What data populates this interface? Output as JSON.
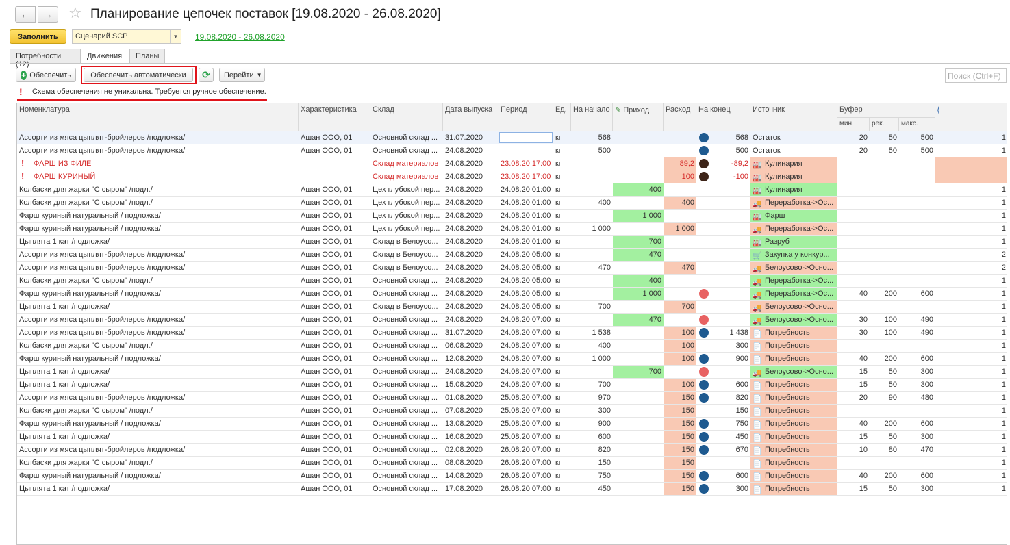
{
  "window": {
    "title": "Планирование цепочек поставок [19.08.2020 - 26.08.2020]"
  },
  "commandbar": {
    "fill_label": "Заполнить",
    "scenario_value": "Сценарий SCP",
    "period_link": "19.08.2020 - 26.08.2020"
  },
  "tabs": [
    {
      "label": "Потребности (12)"
    },
    {
      "label": "Движения"
    },
    {
      "label": "Планы"
    }
  ],
  "toolbar": {
    "provide_label": "Обеспечить",
    "provide_auto_label": "Обеспечить автоматически",
    "goto_label": "Перейти",
    "search_placeholder": "Поиск (Ctrl+F)"
  },
  "warning": {
    "text": "Схема обеспечения не уникальна. Требуется ручное обеспечение."
  },
  "columns": {
    "nom": "Номенклатура",
    "char": "Характеристика",
    "store": "Склад",
    "release": "Дата выпуска",
    "period": "Период",
    "unit": "Ед.",
    "start": "На начало",
    "income": "Приход",
    "expense": "Расход",
    "end": "На конец",
    "source": "Источник",
    "buffer": "Буфер",
    "buf_min": "мин.",
    "buf_rec": "рек.",
    "buf_max": "макс."
  },
  "rows": [
    {
      "nom": "Ассорти из мяса цыплят-бройлеров /подложка/",
      "char": "Ашан ООО, 01",
      "store": "Основной склад ...",
      "release": "31.07.2020",
      "period": "",
      "unit": "кг",
      "start": "568",
      "income": "",
      "expense": "",
      "end": "568",
      "dot": "blue",
      "src": "Остаток",
      "srcbg": "",
      "srcic": "",
      "min": "20",
      "rec": "50",
      "max": "500",
      "last": "1",
      "sel": true
    },
    {
      "nom": "Ассорти из мяса цыплят-бройлеров /подложка/",
      "char": "Ашан ООО, 01",
      "store": "Основной склад ...",
      "release": "24.08.2020",
      "period": "",
      "unit": "кг",
      "start": "500",
      "income": "",
      "expense": "",
      "end": "500",
      "dot": "blue",
      "src": "Остаток",
      "srcbg": "",
      "srcic": "",
      "min": "20",
      "rec": "50",
      "max": "500",
      "last": "1"
    },
    {
      "nom": "ФАРШ ИЗ ФИЛЕ",
      "char": "",
      "store": "Склад материалов",
      "release": "24.08.2020",
      "period": "23.08.20 17:00",
      "unit": "кг",
      "start": "",
      "income": "",
      "expense": "89,2",
      "end": "-89,2",
      "dot": "brown",
      "src": "Кулинария",
      "srcbg": "pink",
      "srcic": "factory",
      "min": "",
      "rec": "",
      "max": "",
      "last": "",
      "warn": true
    },
    {
      "nom": "ФАРШ КУРИНЫЙ",
      "char": "",
      "store": "Склад материалов",
      "release": "24.08.2020",
      "period": "23.08.20 17:00",
      "unit": "кг",
      "start": "",
      "income": "",
      "expense": "100",
      "end": "-100",
      "dot": "brown",
      "src": "Кулинария",
      "srcbg": "pink",
      "srcic": "factory",
      "min": "",
      "rec": "",
      "max": "",
      "last": "",
      "warn": true
    },
    {
      "nom": "Колбаски для жарки  \"С сыром\" /подл./",
      "char": "Ашан ООО, 01",
      "store": "Цех глубокой пер...",
      "release": "24.08.2020",
      "period": "24.08.20 01:00",
      "unit": "кг",
      "start": "",
      "income": "400",
      "expense": "",
      "end": "",
      "dot": "",
      "src": "Кулинария",
      "srcbg": "green",
      "srcic": "factory",
      "min": "",
      "rec": "",
      "max": "",
      "last": "1"
    },
    {
      "nom": "Колбаски для жарки  \"С сыром\" /подл./",
      "char": "Ашан ООО, 01",
      "store": "Цех глубокой пер...",
      "release": "24.08.2020",
      "period": "24.08.20 01:00",
      "unit": "кг",
      "start": "400",
      "income": "",
      "expense": "400",
      "end": "",
      "dot": "",
      "src": "Переработка->Ос...",
      "srcbg": "pink",
      "srcic": "truck",
      "min": "",
      "rec": "",
      "max": "",
      "last": "1"
    },
    {
      "nom": "Фарш куриный натуральный / подложка/",
      "char": "Ашан ООО, 01",
      "store": "Цех глубокой пер...",
      "release": "24.08.2020",
      "period": "24.08.20 01:00",
      "unit": "кг",
      "start": "",
      "income": "1 000",
      "expense": "",
      "end": "",
      "dot": "",
      "src": "Фарш",
      "srcbg": "green",
      "srcic": "factory",
      "min": "",
      "rec": "",
      "max": "",
      "last": "1"
    },
    {
      "nom": "Фарш куриный натуральный / подложка/",
      "char": "Ашан ООО, 01",
      "store": "Цех глубокой пер...",
      "release": "24.08.2020",
      "period": "24.08.20 01:00",
      "unit": "кг",
      "start": "1 000",
      "income": "",
      "expense": "1 000",
      "end": "",
      "dot": "",
      "src": "Переработка->Ос...",
      "srcbg": "pink",
      "srcic": "truck",
      "min": "",
      "rec": "",
      "max": "",
      "last": "1"
    },
    {
      "nom": "Цыплята 1 кат /подложка/",
      "char": "Ашан ООО, 01",
      "store": "Склад  в Белоусо...",
      "release": "24.08.2020",
      "period": "24.08.20 01:00",
      "unit": "кг",
      "start": "",
      "income": "700",
      "expense": "",
      "end": "",
      "dot": "",
      "src": "Разруб",
      "srcbg": "green",
      "srcic": "factory",
      "min": "",
      "rec": "",
      "max": "",
      "last": "1"
    },
    {
      "nom": "Ассорти из мяса цыплят-бройлеров /подложка/",
      "char": "Ашан ООО, 01",
      "store": "Склад  в Белоусо...",
      "release": "24.08.2020",
      "period": "24.08.20 05:00",
      "unit": "кг",
      "start": "",
      "income": "470",
      "expense": "",
      "end": "",
      "dot": "",
      "src": "Закупка у конкур...",
      "srcbg": "green",
      "srcic": "cart",
      "min": "",
      "rec": "",
      "max": "",
      "last": "2"
    },
    {
      "nom": "Ассорти из мяса цыплят-бройлеров /подложка/",
      "char": "Ашан ООО, 01",
      "store": "Склад  в Белоусо...",
      "release": "24.08.2020",
      "period": "24.08.20 05:00",
      "unit": "кг",
      "start": "470",
      "income": "",
      "expense": "470",
      "end": "",
      "dot": "",
      "src": "Белоусово->Осно...",
      "srcbg": "pink",
      "srcic": "truck",
      "min": "",
      "rec": "",
      "max": "",
      "last": "2"
    },
    {
      "nom": "Колбаски для жарки  \"С сыром\" /подл./",
      "char": "Ашан ООО, 01",
      "store": "Основной склад ...",
      "release": "24.08.2020",
      "period": "24.08.20 05:00",
      "unit": "кг",
      "start": "",
      "income": "400",
      "expense": "",
      "end": "",
      "dot": "",
      "src": "Переработка->Ос...",
      "srcbg": "green",
      "srcic": "truck",
      "min": "",
      "rec": "",
      "max": "",
      "last": "1"
    },
    {
      "nom": "Фарш куриный натуральный / подложка/",
      "char": "Ашан ООО, 01",
      "store": "Основной склад ...",
      "release": "24.08.2020",
      "period": "24.08.20 05:00",
      "unit": "кг",
      "start": "",
      "income": "1 000",
      "expense": "",
      "end": "",
      "dot": "pink",
      "src": "Переработка->Ос...",
      "srcbg": "green",
      "srcic": "truck",
      "min": "40",
      "rec": "200",
      "max": "600",
      "last": "1"
    },
    {
      "nom": "Цыплята 1 кат /подложка/",
      "char": "Ашан ООО, 01",
      "store": "Склад  в Белоусо...",
      "release": "24.08.2020",
      "period": "24.08.20 05:00",
      "unit": "кг",
      "start": "700",
      "income": "",
      "expense": "700",
      "end": "",
      "dot": "",
      "src": "Белоусово->Осно...",
      "srcbg": "pink",
      "srcic": "truck",
      "min": "",
      "rec": "",
      "max": "",
      "last": "1"
    },
    {
      "nom": "Ассорти из мяса цыплят-бройлеров /подложка/",
      "char": "Ашан ООО, 01",
      "store": "Основной склад ...",
      "release": "24.08.2020",
      "period": "24.08.20 07:00",
      "unit": "кг",
      "start": "",
      "income": "470",
      "expense": "",
      "end": "",
      "dot": "pink",
      "src": "Белоусово->Осно...",
      "srcbg": "green",
      "srcic": "truck",
      "min": "30",
      "rec": "100",
      "max": "490",
      "last": "1"
    },
    {
      "nom": "Ассорти из мяса цыплят-бройлеров /подложка/",
      "char": "Ашан ООО, 01",
      "store": "Основной склад ...",
      "release": "31.07.2020",
      "period": "24.08.20 07:00",
      "unit": "кг",
      "start": "1 538",
      "income": "",
      "expense": "100",
      "end": "1 438",
      "dot": "blue",
      "src": "Потребность",
      "srcbg": "pink",
      "srcic": "doc",
      "min": "30",
      "rec": "100",
      "max": "490",
      "last": "1"
    },
    {
      "nom": "Колбаски для жарки  \"С сыром\" /подл./",
      "char": "Ашан ООО, 01",
      "store": "Основной склад ...",
      "release": "06.08.2020",
      "period": "24.08.20 07:00",
      "unit": "кг",
      "start": "400",
      "income": "",
      "expense": "100",
      "end": "300",
      "dot": "",
      "src": "Потребность",
      "srcbg": "pink",
      "srcic": "doc",
      "min": "",
      "rec": "",
      "max": "",
      "last": "1"
    },
    {
      "nom": "Фарш куриный натуральный / подложка/",
      "char": "Ашан ООО, 01",
      "store": "Основной склад ...",
      "release": "12.08.2020",
      "period": "24.08.20 07:00",
      "unit": "кг",
      "start": "1 000",
      "income": "",
      "expense": "100",
      "end": "900",
      "dot": "blue",
      "src": "Потребность",
      "srcbg": "pink",
      "srcic": "doc",
      "min": "40",
      "rec": "200",
      "max": "600",
      "last": "1"
    },
    {
      "nom": "Цыплята 1 кат /подложка/",
      "char": "Ашан ООО, 01",
      "store": "Основной склад ...",
      "release": "24.08.2020",
      "period": "24.08.20 07:00",
      "unit": "кг",
      "start": "",
      "income": "700",
      "expense": "",
      "end": "",
      "dot": "pink",
      "src": "Белоусово->Осно...",
      "srcbg": "green",
      "srcic": "truck",
      "min": "15",
      "rec": "50",
      "max": "300",
      "last": "1"
    },
    {
      "nom": "Цыплята 1 кат /подложка/",
      "char": "Ашан ООО, 01",
      "store": "Основной склад ...",
      "release": "15.08.2020",
      "period": "24.08.20 07:00",
      "unit": "кг",
      "start": "700",
      "income": "",
      "expense": "100",
      "end": "600",
      "dot": "blue",
      "src": "Потребность",
      "srcbg": "pink",
      "srcic": "doc",
      "min": "15",
      "rec": "50",
      "max": "300",
      "last": "1"
    },
    {
      "nom": "Ассорти из мяса цыплят-бройлеров /подложка/",
      "char": "Ашан ООО, 01",
      "store": "Основной склад ...",
      "release": "01.08.2020",
      "period": "25.08.20 07:00",
      "unit": "кг",
      "start": "970",
      "income": "",
      "expense": "150",
      "end": "820",
      "dot": "blue",
      "src": "Потребность",
      "srcbg": "pink",
      "srcic": "doc",
      "min": "20",
      "rec": "90",
      "max": "480",
      "last": "1"
    },
    {
      "nom": "Колбаски для жарки  \"С сыром\" /подл./",
      "char": "Ашан ООО, 01",
      "store": "Основной склад ...",
      "release": "07.08.2020",
      "period": "25.08.20 07:00",
      "unit": "кг",
      "start": "300",
      "income": "",
      "expense": "150",
      "end": "150",
      "dot": "",
      "src": "Потребность",
      "srcbg": "pink",
      "srcic": "doc",
      "min": "",
      "rec": "",
      "max": "",
      "last": "1"
    },
    {
      "nom": "Фарш куриный натуральный / подложка/",
      "char": "Ашан ООО, 01",
      "store": "Основной склад ...",
      "release": "13.08.2020",
      "period": "25.08.20 07:00",
      "unit": "кг",
      "start": "900",
      "income": "",
      "expense": "150",
      "end": "750",
      "dot": "blue",
      "src": "Потребность",
      "srcbg": "pink",
      "srcic": "doc",
      "min": "40",
      "rec": "200",
      "max": "600",
      "last": "1"
    },
    {
      "nom": "Цыплята 1 кат /подложка/",
      "char": "Ашан ООО, 01",
      "store": "Основной склад ...",
      "release": "16.08.2020",
      "period": "25.08.20 07:00",
      "unit": "кг",
      "start": "600",
      "income": "",
      "expense": "150",
      "end": "450",
      "dot": "blue",
      "src": "Потребность",
      "srcbg": "pink",
      "srcic": "doc",
      "min": "15",
      "rec": "50",
      "max": "300",
      "last": "1"
    },
    {
      "nom": "Ассорти из мяса цыплят-бройлеров /подложка/",
      "char": "Ашан ООО, 01",
      "store": "Основной склад ...",
      "release": "02.08.2020",
      "period": "26.08.20 07:00",
      "unit": "кг",
      "start": "820",
      "income": "",
      "expense": "150",
      "end": "670",
      "dot": "blue",
      "src": "Потребность",
      "srcbg": "pink",
      "srcic": "doc",
      "min": "10",
      "rec": "80",
      "max": "470",
      "last": "1"
    },
    {
      "nom": "Колбаски для жарки  \"С сыром\" /подл./",
      "char": "Ашан ООО, 01",
      "store": "Основной склад ...",
      "release": "08.08.2020",
      "period": "26.08.20 07:00",
      "unit": "кг",
      "start": "150",
      "income": "",
      "expense": "150",
      "end": "",
      "dot": "",
      "src": "Потребность",
      "srcbg": "pink",
      "srcic": "doc",
      "min": "",
      "rec": "",
      "max": "",
      "last": "1"
    },
    {
      "nom": "Фарш куриный натуральный / подложка/",
      "char": "Ашан ООО, 01",
      "store": "Основной склад ...",
      "release": "14.08.2020",
      "period": "26.08.20 07:00",
      "unit": "кг",
      "start": "750",
      "income": "",
      "expense": "150",
      "end": "600",
      "dot": "blue",
      "src": "Потребность",
      "srcbg": "pink",
      "srcic": "doc",
      "min": "40",
      "rec": "200",
      "max": "600",
      "last": "1"
    },
    {
      "nom": "Цыплята 1 кат /подложка/",
      "char": "Ашан ООО, 01",
      "store": "Основной склад ...",
      "release": "17.08.2020",
      "period": "26.08.20 07:00",
      "unit": "кг",
      "start": "450",
      "income": "",
      "expense": "150",
      "end": "300",
      "dot": "blue",
      "src": "Потребность",
      "srcbg": "pink",
      "srcic": "doc",
      "min": "15",
      "rec": "50",
      "max": "300",
      "last": "1"
    }
  ]
}
